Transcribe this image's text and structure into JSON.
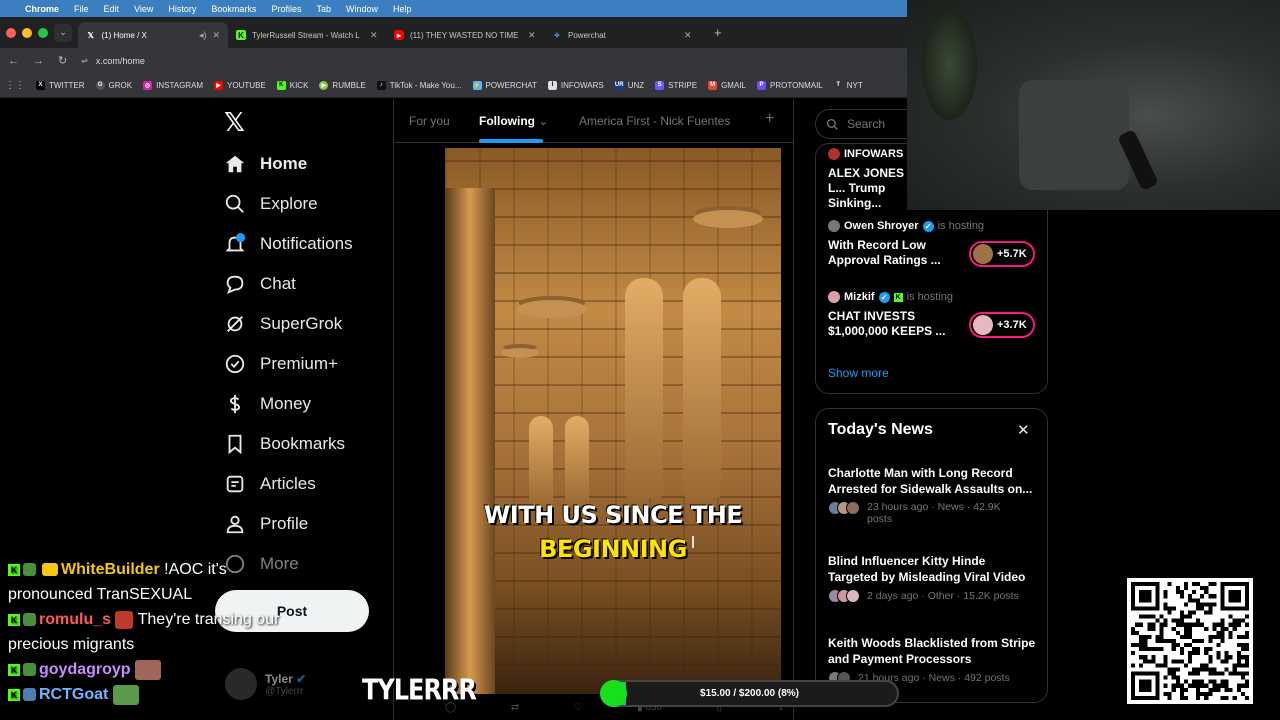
{
  "menubar": {
    "app": "Chrome",
    "items": [
      "File",
      "Edit",
      "View",
      "History",
      "Bookmarks",
      "Profiles",
      "Tab",
      "Window",
      "Help"
    ]
  },
  "tabs": [
    {
      "title": "(1) Home / X",
      "favicon": "x-icon",
      "color": "#ffffff"
    },
    {
      "title": "TylerRussell Stream - Watch L",
      "favicon": "kick-icon",
      "color": "#53fc18"
    },
    {
      "title": "(11) THEY WASTED NO TIME",
      "favicon": "youtube-icon",
      "color": "#ff0000"
    },
    {
      "title": "Powerchat",
      "favicon": "powerchat-icon",
      "color": "#5bb8e8"
    }
  ],
  "address": {
    "url": "x.com/home"
  },
  "bookmarks": [
    {
      "label": "TWITTER",
      "color": "#000000",
      "glyph": "X"
    },
    {
      "label": "GROK",
      "color": "#555555",
      "glyph": "G"
    },
    {
      "label": "INSTAGRAM",
      "color": "#d6249f",
      "glyph": "◎"
    },
    {
      "label": "YOUTUBE",
      "color": "#ff0000",
      "glyph": "▶"
    },
    {
      "label": "KICK",
      "color": "#53fc18",
      "glyph": "K"
    },
    {
      "label": "RUMBLE",
      "color": "#85c742",
      "glyph": "▶"
    },
    {
      "label": "TikTok - Make You...",
      "color": "#111111",
      "glyph": "♪"
    },
    {
      "label": "POWERCHAT",
      "color": "#5bb8e8",
      "glyph": "⚡"
    },
    {
      "label": "INFOWARS",
      "color": "#dddddd",
      "glyph": "I"
    },
    {
      "label": "UNZ",
      "color": "#1a3a8a",
      "glyph": "UR"
    },
    {
      "label": "STRIPE",
      "color": "#635bff",
      "glyph": "S"
    },
    {
      "label": "GMAIL",
      "color": "#ea4335",
      "glyph": "M"
    },
    {
      "label": "PROTONMAIL",
      "color": "#6d4aff",
      "glyph": "P"
    },
    {
      "label": "NYT",
      "color": "#333333",
      "glyph": "T"
    }
  ],
  "nav": {
    "home": "Home",
    "explore": "Explore",
    "notifications": "Notifications",
    "notifications_badge": "1",
    "chat": "Chat",
    "supergrok": "SuperGrok",
    "premium": "Premium+",
    "money": "Money",
    "bookmarks": "Bookmarks",
    "articles": "Articles",
    "profile": "Profile",
    "more": "More",
    "post": "Post"
  },
  "account": {
    "name": "Tyler",
    "handle": "@Tylerrr"
  },
  "feed_tabs": {
    "for_you": "For you",
    "following": "Following",
    "list": "America First - Nick Fuentes"
  },
  "video": {
    "caption_line1": "WITH US SINCE THE",
    "caption_line2": "BEGINNING"
  },
  "tweet_actions": {
    "views": "630"
  },
  "search": {
    "placeholder": "Search"
  },
  "live": {
    "first": {
      "host": "INFOWARS",
      "title": "ALEX JONES L... Trump Sinking..."
    },
    "second": {
      "host": "Owen Shroyer",
      "status": "is hosting",
      "title": "With Record Low Approval Ratings ...",
      "viewers": "+5.7K"
    },
    "third": {
      "host": "Mizkif",
      "status": "is hosting",
      "title": "CHAT INVESTS $1,000,000 KEEPS ...",
      "viewers": "+3.7K"
    },
    "show_more": "Show more"
  },
  "news": {
    "title": "Today's News",
    "items": [
      {
        "headline": "Charlotte Man with Long Record Arrested for Sidewalk Assaults on...",
        "meta": "23 hours ago · News · 42.9K posts"
      },
      {
        "headline": "Blind Influencer Kitty Hinde Targeted by Misleading Viral Video",
        "meta": "2 days ago · Other · 15.2K posts"
      },
      {
        "headline": "Keith Woods Blacklisted from Stripe and Payment Processors",
        "meta": "21 hours ago · News · 492 posts"
      }
    ]
  },
  "chat": [
    {
      "user": "WhiteBuilder",
      "text": "!AOC it's pronounced TranSEXUAL",
      "user_color": "#f5c518"
    },
    {
      "user": "romulu_s",
      "text": "They're transing our precious migrants",
      "user_color": "#ff5a5a"
    },
    {
      "user": "goydagroyp",
      "text": "",
      "user_color": "#c78cff"
    },
    {
      "user": "RCTGoat",
      "text": "",
      "user_color": "#6fb7ff"
    }
  ],
  "overlay": {
    "watermark": "TYLERRR",
    "donation_label": "$15.00 / $200.00 (8%)",
    "donation_progress": 0.08
  },
  "colors": {
    "accent": "#1d9bf0",
    "live_ring": "#f91880",
    "kick": "#53fc18"
  }
}
